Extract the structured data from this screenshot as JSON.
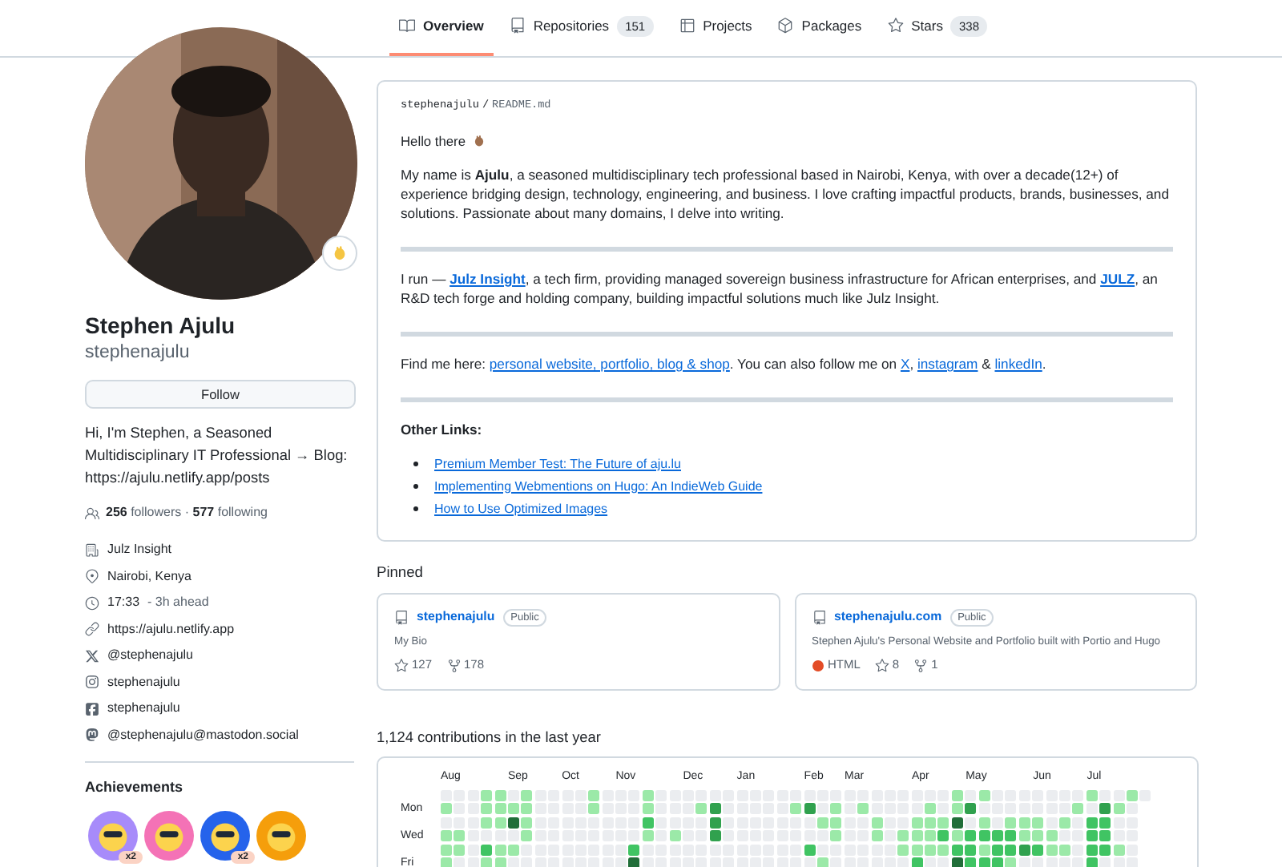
{
  "tabs": [
    {
      "label": "Overview",
      "kind": "book",
      "selected": true
    },
    {
      "label": "Repositories",
      "kind": "repo",
      "count": "151",
      "selected": false
    },
    {
      "label": "Projects",
      "kind": "table",
      "selected": false
    },
    {
      "label": "Packages",
      "kind": "package",
      "selected": false
    },
    {
      "label": "Stars",
      "kind": "star",
      "count": "338",
      "selected": false
    }
  ],
  "profile": {
    "name": "Stephen Ajulu",
    "username": "stephenajulu",
    "follow_button": "Follow",
    "bio": "Hi, I'm Stephen, a Seasoned Multidisciplinary IT Professional → Blog: https://ajulu.netlify.app/posts",
    "social": "**256** followers · **577** following",
    "details": [
      {
        "kind": "org",
        "text": "Julz Insight"
      },
      {
        "kind": "location",
        "text": "Nairobi, Kenya"
      },
      {
        "kind": "time",
        "text": "17:33",
        "note": "- 3h ahead"
      },
      {
        "kind": "link",
        "text": "https://ajulu.netlify.app"
      },
      {
        "kind": "x",
        "text": "@stephenajulu"
      },
      {
        "kind": "instagram",
        "text": "stephenajulu"
      },
      {
        "kind": "facebook",
        "text": "stephenajulu"
      },
      {
        "kind": "mastodon",
        "text": "@stephenajulu@mastodon.social"
      }
    ],
    "achievements_title": "Achievements",
    "achievements": [
      {
        "color": "#a78bfa",
        "count": "x2"
      },
      {
        "color": "#f472b6"
      },
      {
        "color": "#2563eb",
        "count": "x2"
      },
      {
        "color": "#f59e0b"
      }
    ]
  },
  "readme": {
    "path_user": "stephenajulu",
    "path_separator": "/",
    "path_file": "README.md",
    "greeting": "Hello there",
    "intro": "My name is **Ajulu**, a seasoned multidisciplinary tech professional based in Nairobi, Kenya, with over a decade(12+) of experience bridging design, technology, engineering, and business. I love crafting impactful products, brands, businesses, and solutions. Passionate about many domains, I delve into writing.",
    "run": [
      {
        "kind": "text",
        "text": "I run — "
      },
      {
        "kind": "strong-link",
        "text": "Julz Insight"
      },
      {
        "kind": "text",
        "text": ", a tech firm, providing managed sovereign business infrastructure for African enterprises, and "
      },
      {
        "kind": "strong-link",
        "text": "JULZ"
      },
      {
        "kind": "text",
        "text": ", an R&D tech forge and holding company, building impactful solutions much like Julz Insight."
      }
    ],
    "find": [
      {
        "kind": "text",
        "text": "Find me here: "
      },
      {
        "kind": "link",
        "text": "personal website, portfolio, blog & shop"
      },
      {
        "kind": "text",
        "text": ". You can also follow me on "
      },
      {
        "kind": "link",
        "text": "X"
      },
      {
        "kind": "text",
        "text": ", "
      },
      {
        "kind": "link",
        "text": "instagram"
      },
      {
        "kind": "text",
        "text": " & "
      },
      {
        "kind": "link",
        "text": "linkedIn"
      },
      {
        "kind": "text",
        "text": "."
      }
    ],
    "other_title": "Other Links:",
    "other_links": [
      "Premium Member Test: The Future of aju.lu",
      "Implementing Webmentions on Hugo: An IndieWeb Guide",
      "How to Use Optimized Images"
    ]
  },
  "pinned": {
    "title": "Pinned",
    "repos": [
      {
        "name": "stephenajulu",
        "visibility": "Public",
        "description": "My Bio",
        "stars": "127",
        "forks": "178"
      },
      {
        "name": "stephenajulu.com",
        "visibility": "Public",
        "description": "Stephen Ajulu's Personal Website and Portfolio built with Portio and Hugo",
        "language": {
          "name": "HTML",
          "color": "#e34c26"
        },
        "stars": "8",
        "forks": "1"
      }
    ]
  },
  "contributions": {
    "title": "1,124 contributions in the last year",
    "months": [
      "Aug",
      "Sep",
      "Oct",
      "Nov",
      "Dec",
      "Jan",
      "Feb",
      "Mar",
      "Apr",
      "May",
      "Jun",
      "Jul"
    ],
    "rows": [
      {
        "cells": [
          {
            "color": "#ebedf0"
          },
          {
            "color": "#ebedf0"
          },
          {
            "color": "#ebedf0"
          },
          {
            "color": "#9be9a8"
          },
          {
            "color": "#9be9a8"
          },
          {
            "color": "#ebedf0"
          },
          {
            "color": "#9be9a8"
          },
          {
            "color": "#ebedf0"
          },
          {
            "color": "#ebedf0"
          },
          {
            "color": "#ebedf0"
          },
          {
            "color": "#ebedf0"
          },
          {
            "color": "#9be9a8"
          },
          {
            "color": "#ebedf0"
          },
          {
            "color": "#ebedf0"
          },
          {
            "color": "#ebedf0"
          },
          {
            "color": "#9be9a8"
          },
          {
            "color": "#ebedf0"
          },
          {
            "color": "#ebedf0"
          },
          {
            "color": "#ebedf0"
          },
          {
            "color": "#ebedf0"
          },
          {
            "color": "#ebedf0"
          },
          {
            "color": "#ebedf0"
          },
          {
            "color": "#ebedf0"
          },
          {
            "color": "#ebedf0"
          },
          {
            "color": "#ebedf0"
          },
          {
            "color": "#ebedf0"
          },
          {
            "color": "#ebedf0"
          },
          {
            "color": "#ebedf0"
          },
          {
            "color": "#ebedf0"
          },
          {
            "color": "#ebedf0"
          },
          {
            "color": "#ebedf0"
          },
          {
            "color": "#ebedf0"
          },
          {
            "color": "#ebedf0"
          },
          {
            "color": "#ebedf0"
          },
          {
            "color": "#ebedf0"
          },
          {
            "color": "#ebedf0"
          },
          {
            "color": "#ebedf0"
          },
          {
            "color": "#ebedf0"
          },
          {
            "color": "#9be9a8"
          },
          {
            "color": "#ebedf0"
          },
          {
            "color": "#9be9a8"
          },
          {
            "color": "#ebedf0"
          },
          {
            "color": "#ebedf0"
          },
          {
            "color": "#ebedf0"
          },
          {
            "color": "#ebedf0"
          },
          {
            "color": "#ebedf0"
          },
          {
            "color": "#ebedf0"
          },
          {
            "color": "#ebedf0"
          },
          {
            "color": "#9be9a8"
          },
          {
            "color": "#ebedf0"
          },
          {
            "color": "#ebedf0"
          },
          {
            "color": "#9be9a8"
          },
          {
            "color": "#ebedf0"
          }
        ]
      },
      {
        "label": "Mon",
        "cells": [
          {
            "color": "#9be9a8"
          },
          {
            "color": "#ebedf0"
          },
          {
            "color": "#ebedf0"
          },
          {
            "color": "#9be9a8"
          },
          {
            "color": "#9be9a8"
          },
          {
            "color": "#9be9a8"
          },
          {
            "color": "#9be9a8"
          },
          {
            "color": "#ebedf0"
          },
          {
            "color": "#ebedf0"
          },
          {
            "color": "#ebedf0"
          },
          {
            "color": "#ebedf0"
          },
          {
            "color": "#9be9a8"
          },
          {
            "color": "#ebedf0"
          },
          {
            "color": "#ebedf0"
          },
          {
            "color": "#ebedf0"
          },
          {
            "color": "#9be9a8"
          },
          {
            "color": "#ebedf0"
          },
          {
            "color": "#ebedf0"
          },
          {
            "color": "#ebedf0"
          },
          {
            "color": "#9be9a8"
          },
          {
            "color": "#30a14e"
          },
          {
            "color": "#ebedf0"
          },
          {
            "color": "#ebedf0"
          },
          {
            "color": "#ebedf0"
          },
          {
            "color": "#ebedf0"
          },
          {
            "color": "#ebedf0"
          },
          {
            "color": "#9be9a8"
          },
          {
            "color": "#30a14e"
          },
          {
            "color": "#ebedf0"
          },
          {
            "color": "#9be9a8"
          },
          {
            "color": "#ebedf0"
          },
          {
            "color": "#9be9a8"
          },
          {
            "color": "#ebedf0"
          },
          {
            "color": "#ebedf0"
          },
          {
            "color": "#ebedf0"
          },
          {
            "color": "#ebedf0"
          },
          {
            "color": "#9be9a8"
          },
          {
            "color": "#ebedf0"
          },
          {
            "color": "#9be9a8"
          },
          {
            "color": "#30a14e"
          },
          {
            "color": "#ebedf0"
          },
          {
            "color": "#ebedf0"
          },
          {
            "color": "#ebedf0"
          },
          {
            "color": "#ebedf0"
          },
          {
            "color": "#ebedf0"
          },
          {
            "color": "#ebedf0"
          },
          {
            "color": "#ebedf0"
          },
          {
            "color": "#9be9a8"
          },
          {
            "color": "#ebedf0"
          },
          {
            "color": "#30a14e"
          },
          {
            "color": "#9be9a8"
          },
          {
            "color": "#ebedf0"
          }
        ]
      },
      {
        "cells": [
          {
            "color": "#ebedf0"
          },
          {
            "color": "#ebedf0"
          },
          {
            "color": "#ebedf0"
          },
          {
            "color": "#9be9a8"
          },
          {
            "color": "#9be9a8"
          },
          {
            "color": "#216e39"
          },
          {
            "color": "#9be9a8"
          },
          {
            "color": "#ebedf0"
          },
          {
            "color": "#ebedf0"
          },
          {
            "color": "#ebedf0"
          },
          {
            "color": "#ebedf0"
          },
          {
            "color": "#ebedf0"
          },
          {
            "color": "#ebedf0"
          },
          {
            "color": "#ebedf0"
          },
          {
            "color": "#ebedf0"
          },
          {
            "color": "#40c463"
          },
          {
            "color": "#ebedf0"
          },
          {
            "color": "#ebedf0"
          },
          {
            "color": "#ebedf0"
          },
          {
            "color": "#ebedf0"
          },
          {
            "color": "#30a14e"
          },
          {
            "color": "#ebedf0"
          },
          {
            "color": "#ebedf0"
          },
          {
            "color": "#ebedf0"
          },
          {
            "color": "#ebedf0"
          },
          {
            "color": "#ebedf0"
          },
          {
            "color": "#ebedf0"
          },
          {
            "color": "#ebedf0"
          },
          {
            "color": "#9be9a8"
          },
          {
            "color": "#9be9a8"
          },
          {
            "color": "#ebedf0"
          },
          {
            "color": "#ebedf0"
          },
          {
            "color": "#9be9a8"
          },
          {
            "color": "#ebedf0"
          },
          {
            "color": "#ebedf0"
          },
          {
            "color": "#9be9a8"
          },
          {
            "color": "#9be9a8"
          },
          {
            "color": "#9be9a8"
          },
          {
            "color": "#216e39"
          },
          {
            "color": "#ebedf0"
          },
          {
            "color": "#9be9a8"
          },
          {
            "color": "#ebedf0"
          },
          {
            "color": "#9be9a8"
          },
          {
            "color": "#9be9a8"
          },
          {
            "color": "#9be9a8"
          },
          {
            "color": "#ebedf0"
          },
          {
            "color": "#9be9a8"
          },
          {
            "color": "#ebedf0"
          },
          {
            "color": "#40c463"
          },
          {
            "color": "#40c463"
          },
          {
            "color": "#ebedf0"
          },
          {
            "color": "#ebedf0"
          }
        ]
      },
      {
        "label": "Wed",
        "cells": [
          {
            "color": "#9be9a8"
          },
          {
            "color": "#9be9a8"
          },
          {
            "color": "#ebedf0"
          },
          {
            "color": "#ebedf0"
          },
          {
            "color": "#ebedf0"
          },
          {
            "color": "#ebedf0"
          },
          {
            "color": "#9be9a8"
          },
          {
            "color": "#ebedf0"
          },
          {
            "color": "#ebedf0"
          },
          {
            "color": "#ebedf0"
          },
          {
            "color": "#ebedf0"
          },
          {
            "color": "#ebedf0"
          },
          {
            "color": "#ebedf0"
          },
          {
            "color": "#ebedf0"
          },
          {
            "color": "#ebedf0"
          },
          {
            "color": "#9be9a8"
          },
          {
            "color": "#ebedf0"
          },
          {
            "color": "#9be9a8"
          },
          {
            "color": "#ebedf0"
          },
          {
            "color": "#ebedf0"
          },
          {
            "color": "#30a14e"
          },
          {
            "color": "#ebedf0"
          },
          {
            "color": "#ebedf0"
          },
          {
            "color": "#ebedf0"
          },
          {
            "color": "#ebedf0"
          },
          {
            "color": "#ebedf0"
          },
          {
            "color": "#ebedf0"
          },
          {
            "color": "#ebedf0"
          },
          {
            "color": "#ebedf0"
          },
          {
            "color": "#9be9a8"
          },
          {
            "color": "#ebedf0"
          },
          {
            "color": "#ebedf0"
          },
          {
            "color": "#9be9a8"
          },
          {
            "color": "#ebedf0"
          },
          {
            "color": "#9be9a8"
          },
          {
            "color": "#9be9a8"
          },
          {
            "color": "#9be9a8"
          },
          {
            "color": "#40c463"
          },
          {
            "color": "#9be9a8"
          },
          {
            "color": "#40c463"
          },
          {
            "color": "#40c463"
          },
          {
            "color": "#40c463"
          },
          {
            "color": "#40c463"
          },
          {
            "color": "#9be9a8"
          },
          {
            "color": "#9be9a8"
          },
          {
            "color": "#9be9a8"
          },
          {
            "color": "#ebedf0"
          },
          {
            "color": "#ebedf0"
          },
          {
            "color": "#40c463"
          },
          {
            "color": "#40c463"
          },
          {
            "color": "#ebedf0"
          },
          {
            "color": "#ebedf0"
          }
        ]
      },
      {
        "cells": [
          {
            "color": "#9be9a8"
          },
          {
            "color": "#9be9a8"
          },
          {
            "color": "#ebedf0"
          },
          {
            "color": "#40c463"
          },
          {
            "color": "#9be9a8"
          },
          {
            "color": "#9be9a8"
          },
          {
            "color": "#ebedf0"
          },
          {
            "color": "#ebedf0"
          },
          {
            "color": "#ebedf0"
          },
          {
            "color": "#ebedf0"
          },
          {
            "color": "#ebedf0"
          },
          {
            "color": "#ebedf0"
          },
          {
            "color": "#ebedf0"
          },
          {
            "color": "#ebedf0"
          },
          {
            "color": "#40c463"
          },
          {
            "color": "#ebedf0"
          },
          {
            "color": "#ebedf0"
          },
          {
            "color": "#ebedf0"
          },
          {
            "color": "#ebedf0"
          },
          {
            "color": "#ebedf0"
          },
          {
            "color": "#ebedf0"
          },
          {
            "color": "#ebedf0"
          },
          {
            "color": "#ebedf0"
          },
          {
            "color": "#ebedf0"
          },
          {
            "color": "#ebedf0"
          },
          {
            "color": "#ebedf0"
          },
          {
            "color": "#ebedf0"
          },
          {
            "color": "#40c463"
          },
          {
            "color": "#ebedf0"
          },
          {
            "color": "#ebedf0"
          },
          {
            "color": "#ebedf0"
          },
          {
            "color": "#ebedf0"
          },
          {
            "color": "#ebedf0"
          },
          {
            "color": "#ebedf0"
          },
          {
            "color": "#9be9a8"
          },
          {
            "color": "#9be9a8"
          },
          {
            "color": "#9be9a8"
          },
          {
            "color": "#9be9a8"
          },
          {
            "color": "#40c463"
          },
          {
            "color": "#40c463"
          },
          {
            "color": "#9be9a8"
          },
          {
            "color": "#40c463"
          },
          {
            "color": "#40c463"
          },
          {
            "color": "#30a14e"
          },
          {
            "color": "#40c463"
          },
          {
            "color": "#9be9a8"
          },
          {
            "color": "#9be9a8"
          },
          {
            "color": "#ebedf0"
          },
          {
            "color": "#40c463"
          },
          {
            "color": "#40c463"
          },
          {
            "color": "#9be9a8"
          },
          {
            "color": "#ebedf0"
          }
        ]
      },
      {
        "label": "Fri",
        "cells": [
          {
            "color": "#9be9a8"
          },
          {
            "color": "#ebedf0"
          },
          {
            "color": "#ebedf0"
          },
          {
            "color": "#9be9a8"
          },
          {
            "color": "#9be9a8"
          },
          {
            "color": "#ebedf0"
          },
          {
            "color": "#ebedf0"
          },
          {
            "color": "#ebedf0"
          },
          {
            "color": "#ebedf0"
          },
          {
            "color": "#ebedf0"
          },
          {
            "color": "#ebedf0"
          },
          {
            "color": "#ebedf0"
          },
          {
            "color": "#ebedf0"
          },
          {
            "color": "#ebedf0"
          },
          {
            "color": "#216e39"
          },
          {
            "color": "#ebedf0"
          },
          {
            "color": "#ebedf0"
          },
          {
            "color": "#ebedf0"
          },
          {
            "color": "#ebedf0"
          },
          {
            "color": "#ebedf0"
          },
          {
            "color": "#ebedf0"
          },
          {
            "color": "#ebedf0"
          },
          {
            "color": "#ebedf0"
          },
          {
            "color": "#ebedf0"
          },
          {
            "color": "#ebedf0"
          },
          {
            "color": "#ebedf0"
          },
          {
            "color": "#ebedf0"
          },
          {
            "color": "#ebedf0"
          },
          {
            "color": "#9be9a8"
          },
          {
            "color": "#ebedf0"
          },
          {
            "color": "#ebedf0"
          },
          {
            "color": "#ebedf0"
          },
          {
            "color": "#ebedf0"
          },
          {
            "color": "#ebedf0"
          },
          {
            "color": "#ebedf0"
          },
          {
            "color": "#40c463"
          },
          {
            "color": "#ebedf0"
          },
          {
            "color": "#ebedf0"
          },
          {
            "color": "#216e39"
          },
          {
            "color": "#40c463"
          },
          {
            "color": "#40c463"
          },
          {
            "color": "#40c463"
          },
          {
            "color": "#9be9a8"
          },
          {
            "color": "#ebedf0"
          },
          {
            "color": "#ebedf0"
          },
          {
            "color": "#ebedf0"
          },
          {
            "color": "#ebedf0"
          },
          {
            "color": "#ebedf0"
          },
          {
            "color": "#40c463"
          },
          {
            "color": "#ebedf0"
          },
          {
            "color": "#ebedf0"
          },
          {
            "color": "#ebedf0"
          }
        ]
      }
    ]
  }
}
